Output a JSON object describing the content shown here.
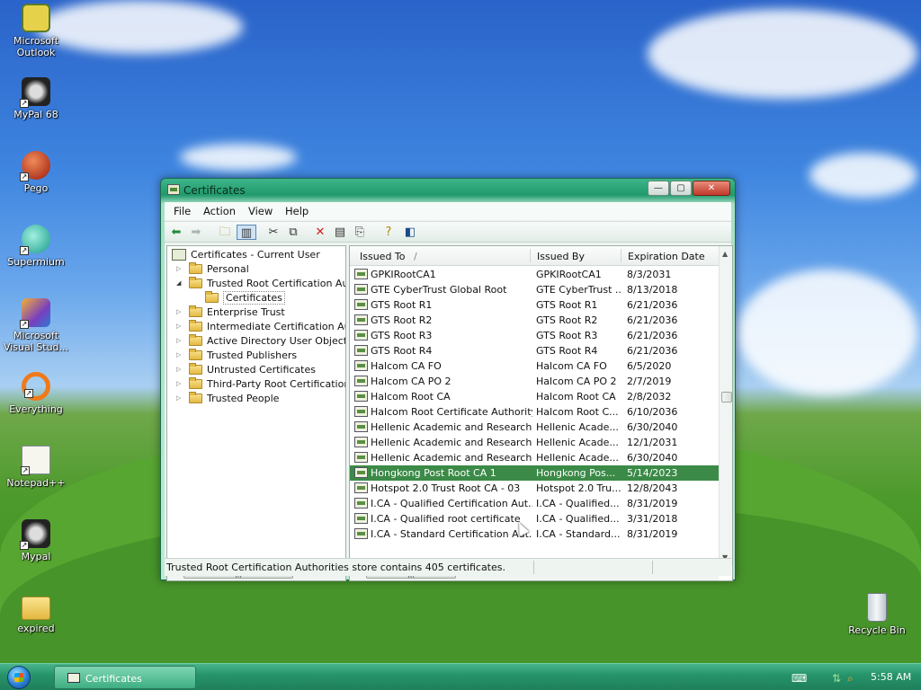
{
  "desktop": {
    "icons": [
      {
        "label_line1": "Microsoft",
        "label_line2": "Outlook"
      },
      {
        "label_line1": "MyPal 68",
        "label_line2": ""
      },
      {
        "label_line1": "Pego",
        "label_line2": ""
      },
      {
        "label_line1": "Supermium",
        "label_line2": ""
      },
      {
        "label_line1": "Microsoft",
        "label_line2": "Visual Stud..."
      },
      {
        "label_line1": "Everything",
        "label_line2": ""
      },
      {
        "label_line1": "Notepad++",
        "label_line2": ""
      },
      {
        "label_line1": "Mypal",
        "label_line2": ""
      },
      {
        "label_line1": "expired",
        "label_line2": ""
      },
      {
        "label_line1": "Recycle Bin",
        "label_line2": ""
      }
    ]
  },
  "window": {
    "title": "Certificates",
    "title_buttons": {
      "minimize": "—",
      "maximize": "▢",
      "close": "✕"
    },
    "menu": [
      "File",
      "Action",
      "View",
      "Help"
    ],
    "toolbar_icons": [
      "back-icon",
      "forward-icon",
      "up-folder-icon",
      "show-hide-tree-icon",
      "cut-icon",
      "copy-icon",
      "delete-icon",
      "properties-icon",
      "export-icon",
      "help-icon",
      "action-pane-icon"
    ],
    "tree": {
      "root": "Certificates - Current User",
      "items": [
        {
          "label": "Personal",
          "expanded": false
        },
        {
          "label": "Trusted Root Certification Authorities",
          "expanded": true
        },
        {
          "label": "Certificates",
          "child": true
        },
        {
          "label": "Enterprise Trust",
          "expanded": false
        },
        {
          "label": "Intermediate Certification Authorities",
          "expanded": false
        },
        {
          "label": "Active Directory User Object",
          "expanded": false
        },
        {
          "label": "Trusted Publishers",
          "expanded": false
        },
        {
          "label": "Untrusted Certificates",
          "expanded": false
        },
        {
          "label": "Third-Party Root Certification Authorities",
          "expanded": false
        },
        {
          "label": "Trusted People",
          "expanded": false
        }
      ]
    },
    "list": {
      "columns": [
        "Issued To",
        "Issued By",
        "Expiration Date"
      ],
      "sort_indicator": "/",
      "rows": [
        {
          "issued_to": "GPKIRootCA1",
          "issued_by": "GPKIRootCA1",
          "expires": "8/3/2031"
        },
        {
          "issued_to": "GTE CyberTrust Global Root",
          "issued_by": "GTE CyberTrust ...",
          "expires": "8/13/2018"
        },
        {
          "issued_to": "GTS Root R1",
          "issued_by": "GTS Root R1",
          "expires": "6/21/2036"
        },
        {
          "issued_to": "GTS Root R2",
          "issued_by": "GTS Root R2",
          "expires": "6/21/2036"
        },
        {
          "issued_to": "GTS Root R3",
          "issued_by": "GTS Root R3",
          "expires": "6/21/2036"
        },
        {
          "issued_to": "GTS Root R4",
          "issued_by": "GTS Root R4",
          "expires": "6/21/2036"
        },
        {
          "issued_to": "Halcom CA FO",
          "issued_by": "Halcom CA FO",
          "expires": "6/5/2020"
        },
        {
          "issued_to": "Halcom CA PO 2",
          "issued_by": "Halcom CA PO 2",
          "expires": "2/7/2019"
        },
        {
          "issued_to": "Halcom Root CA",
          "issued_by": "Halcom Root CA",
          "expires": "2/8/2032"
        },
        {
          "issued_to": "Halcom Root Certificate Authority",
          "issued_by": "Halcom Root C...",
          "expires": "6/10/2036"
        },
        {
          "issued_to": "Hellenic Academic and Research ...",
          "issued_by": "Hellenic Acade...",
          "expires": "6/30/2040"
        },
        {
          "issued_to": "Hellenic Academic and Research ...",
          "issued_by": "Hellenic Acade...",
          "expires": "12/1/2031"
        },
        {
          "issued_to": "Hellenic Academic and Research ...",
          "issued_by": "Hellenic Acade...",
          "expires": "6/30/2040"
        },
        {
          "issued_to": "Hongkong Post Root CA 1",
          "issued_by": "Hongkong Pos...",
          "expires": "5/14/2023",
          "selected": true
        },
        {
          "issued_to": "Hotspot 2.0 Trust Root CA - 03",
          "issued_by": "Hotspot 2.0 Tru...",
          "expires": "12/8/2043"
        },
        {
          "issued_to": "I.CA - Qualified Certification Aut...",
          "issued_by": "I.CA - Qualified...",
          "expires": "8/31/2019"
        },
        {
          "issued_to": "I.CA - Qualified root certificate",
          "issued_by": "I.CA - Qualified...",
          "expires": "3/31/2018"
        },
        {
          "issued_to": "I.CA - Standard Certification Aut...",
          "issued_by": "I.CA - Standard...",
          "expires": "8/31/2019"
        }
      ]
    },
    "status": "Trusted Root Certification Authorities store contains 405 certificates."
  },
  "taskbar": {
    "task_button": "Certificates",
    "clock": "5:58 AM"
  }
}
